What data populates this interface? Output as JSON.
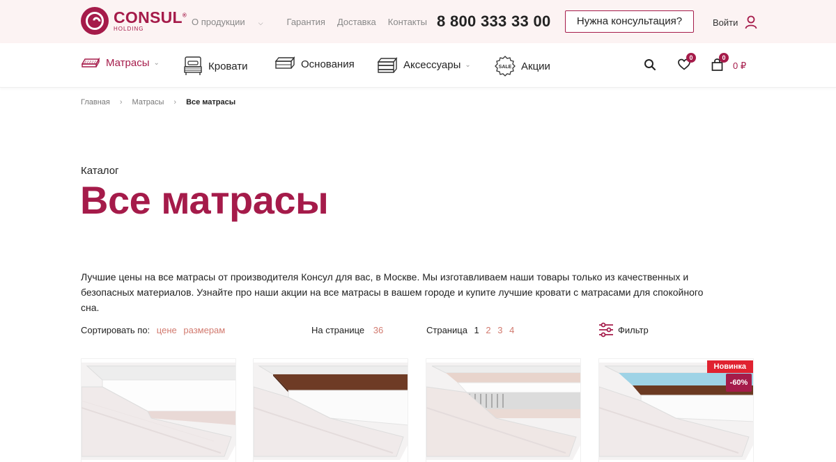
{
  "brand": {
    "name": "CONSUL",
    "registered": "®",
    "sub": "HOLDING",
    "color": "#a51b4a"
  },
  "topnav": {
    "items": [
      {
        "label": "О продукции",
        "has_dropdown": true
      },
      {
        "label": "Гарантия"
      },
      {
        "label": "Доставка"
      },
      {
        "label": "Контакты"
      }
    ],
    "phone": "8 800 333 33 00",
    "consult_button": "Нужна консультация?",
    "login": "Войти"
  },
  "mainnav": {
    "items": [
      {
        "label": "Матрасы",
        "icon": "mattress-icon",
        "active": true,
        "has_dropdown": true
      },
      {
        "label": "Кровати",
        "icon": "bed-icon"
      },
      {
        "label": "Основания",
        "icon": "base-icon"
      },
      {
        "label": "Аксессуары",
        "icon": "accessories-icon",
        "has_dropdown": true
      },
      {
        "label": "Акции",
        "icon": "sale-icon"
      }
    ],
    "sale_icon_text": "SALE",
    "favorites_count": "0",
    "cart_count": "0",
    "cart_sum": "0 ₽"
  },
  "breadcrumb": [
    "Главная",
    "Матрасы",
    "Все матрасы"
  ],
  "catalog_label": "Каталог",
  "page_title": "Все матрасы",
  "intro": "Лучшие цены на все матрасы от производителя Консул для вас, в Москве. Мы изготавливаем наши товары только из качественных и безопасных материалов. Узнайте про наши акции на все матрасы в вашем городе и купите лучшие кровати с матрасами для спокойного сна.",
  "controls": {
    "sort_label": "Сортировать по:",
    "sort_options": [
      "цене",
      "размерам"
    ],
    "per_page_label": "На странице",
    "per_page_value": "36",
    "page_label": "Страница",
    "current_page": "1",
    "pages": [
      "2",
      "3",
      "4"
    ],
    "filter_label": "Фильтр"
  },
  "products": [
    {
      "layer": "white"
    },
    {
      "layer": "coconut"
    },
    {
      "layer": "spring"
    },
    {
      "layer": "blue-coconut",
      "badge_new": "Новинка",
      "badge_discount": "-60%"
    }
  ]
}
